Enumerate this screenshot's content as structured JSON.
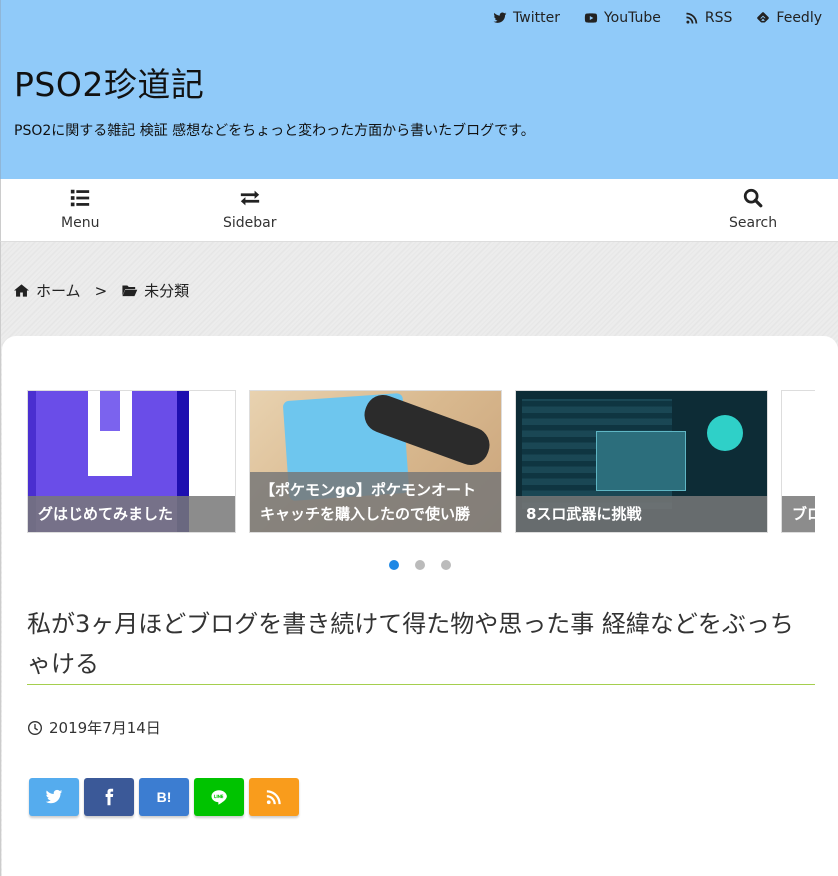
{
  "header": {
    "site_title": "PSO2珍道記",
    "site_description": "PSO2に関する雑記 検証 感想などをちょっと変わった方面から書いたブログです。",
    "social": [
      {
        "label": "Twitter",
        "icon": "twitter-icon"
      },
      {
        "label": "YouTube",
        "icon": "youtube-icon"
      },
      {
        "label": "RSS",
        "icon": "rss-icon"
      },
      {
        "label": "Feedly",
        "icon": "feedly-icon"
      }
    ],
    "background_color": "#90caf9"
  },
  "nav": {
    "menu_label": "Menu",
    "sidebar_label": "Sidebar",
    "search_label": "Search"
  },
  "breadcrumb": {
    "home_label": "ホーム",
    "separator": ">",
    "category_label": "未分類"
  },
  "carousel": {
    "slides": [
      {
        "caption": "グはじめてみました"
      },
      {
        "caption": "【ポケモンgo】ポケモンオートキャッチを購入したので使い勝"
      },
      {
        "caption": "8スロ武器に挑戦"
      },
      {
        "caption": "ブロ"
      }
    ],
    "active_index": 0,
    "dot_count": 3
  },
  "article": {
    "title": "私が3ヶ月ほどブログを書き続けて得た物や思った事 経緯などをぶっちゃける",
    "date": "2019年7月14日",
    "accent_color": "#a5cf4e"
  },
  "share": {
    "buttons": [
      {
        "name": "twitter",
        "color": "#55acee"
      },
      {
        "name": "facebook",
        "color": "#3b5998"
      },
      {
        "name": "hatena",
        "label": "B!",
        "color": "#3c7dd1"
      },
      {
        "name": "line",
        "color": "#00c300"
      },
      {
        "name": "feedly",
        "color": "#f99c1c"
      }
    ]
  }
}
